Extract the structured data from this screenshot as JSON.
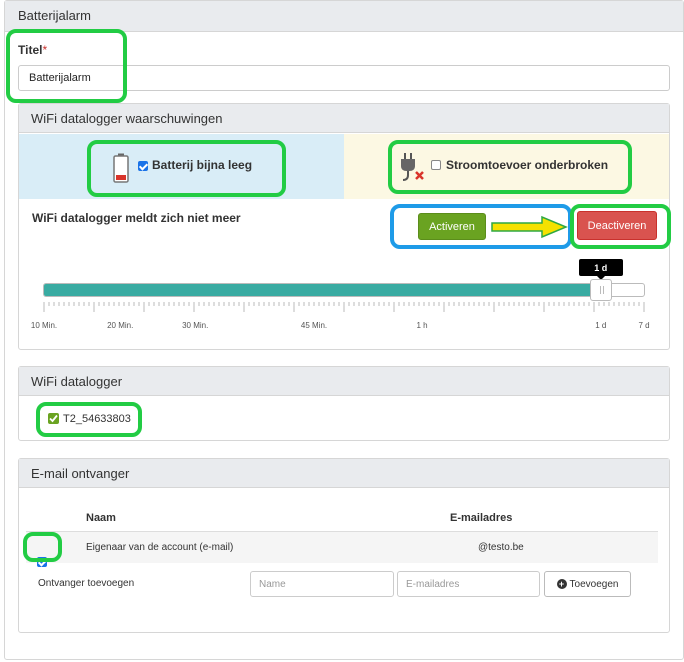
{
  "header": {
    "title": "Batterijalarm"
  },
  "titel": {
    "label": "Titel",
    "required_mark": "*",
    "value": "Batterijalarm"
  },
  "warnings_panel": {
    "title": "WiFi datalogger waarschuwingen",
    "battery": {
      "label": "Batterij bijna leeg",
      "checked": true,
      "icon": "battery-low-icon"
    },
    "power": {
      "label": "Stroomtoevoer onderbroken",
      "checked": false,
      "icon": "power-plug-disconnected-icon"
    },
    "no_report": {
      "label": "WiFi datalogger meldt zich niet meer",
      "activate_label": "Activeren",
      "deactivate_label": "Deactiveren"
    },
    "slider": {
      "value_label": "1 d",
      "fill_fraction": 0.928,
      "ticks": [
        "10 Min.",
        "20 Min.",
        "30 Min.",
        "45 Min.",
        "1 h",
        "1 d",
        "7 d"
      ]
    }
  },
  "logger_panel": {
    "title": "WiFi datalogger",
    "items": [
      {
        "label": "T2_54633803",
        "checked": true
      }
    ]
  },
  "email_panel": {
    "title": "E-mail ontvanger",
    "columns": {
      "name": "Naam",
      "email": "E-mailadres"
    },
    "rows": [
      {
        "checked": true,
        "name": "Eigenaar van de account (e-mail)",
        "email": "@testo.be"
      }
    ],
    "add": {
      "label": "Ontvanger toevoegen",
      "name_placeholder": "Name",
      "email_placeholder": "E-mailadres",
      "button_label": "Toevoegen"
    }
  },
  "colors": {
    "accent_teal": "#39aba2",
    "activate_green": "#6aa321",
    "deactivate_red": "#d9534f",
    "annotation_green": "#22cc44",
    "annotation_blue": "#1e9be8",
    "arrow_yellow": "#f5e100"
  }
}
